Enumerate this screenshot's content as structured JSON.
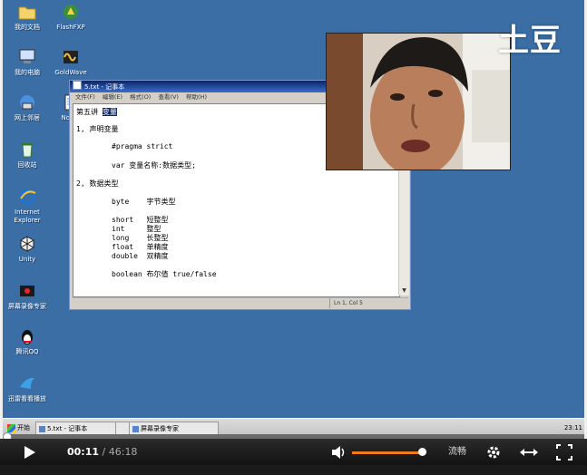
{
  "desktop_icons": [
    {
      "id": "my-documents",
      "label": "我的文档"
    },
    {
      "id": "flashfxp",
      "label": "FlashFXP"
    },
    {
      "id": "my-computer",
      "label": "我的电脑"
    },
    {
      "id": "goldwave",
      "label": "GoldWave"
    },
    {
      "id": "network",
      "label": "网上邻居"
    },
    {
      "id": "notepad",
      "label": "Notep"
    },
    {
      "id": "recycle-bin",
      "label": "回收站"
    },
    {
      "id": "ie",
      "label": "Internet Explorer"
    },
    {
      "id": "unity",
      "label": "Unity"
    },
    {
      "id": "recorder",
      "label": "屏幕录像专家"
    },
    {
      "id": "qq",
      "label": "腾讯QQ"
    },
    {
      "id": "downloader",
      "label": "迅雷看看播放"
    }
  ],
  "notepad": {
    "title": "5.txt - 记事本",
    "menu": [
      "文件(F)",
      "编辑(E)",
      "格式(O)",
      "查看(V)",
      "帮助(H)"
    ],
    "lines": {
      "l1_pre": "第五讲 ",
      "l1_sel": "变量",
      "l2": "1, 声明变量",
      "l3": "#pragma strict",
      "l4": "var 变量名称:数据类型;",
      "l5": "2, 数据类型",
      "l6": "byte    字节类型",
      "l7": "short   短整型",
      "l8": "int     整型",
      "l9": "long    长整型",
      "l10": "float   单精度",
      "l11": "double  双精度",
      "l12": "boolean 布尔值 true/false"
    },
    "status": "Ln 1, Col 5"
  },
  "watermark": "土豆",
  "taskbar": {
    "start": "开始",
    "buttons": [
      "5.txt - 记事本",
      "",
      "屏幕录像专家"
    ],
    "clock": "23:11"
  },
  "player": {
    "current_time": "00:11",
    "separator": "/",
    "duration": "46:18",
    "progress_fraction": 0.004,
    "volume_fraction": 0.95,
    "quality_label": "流畅"
  },
  "colors": {
    "desktop": "#3a6ea5",
    "volume_accent": "#f07a1e"
  }
}
